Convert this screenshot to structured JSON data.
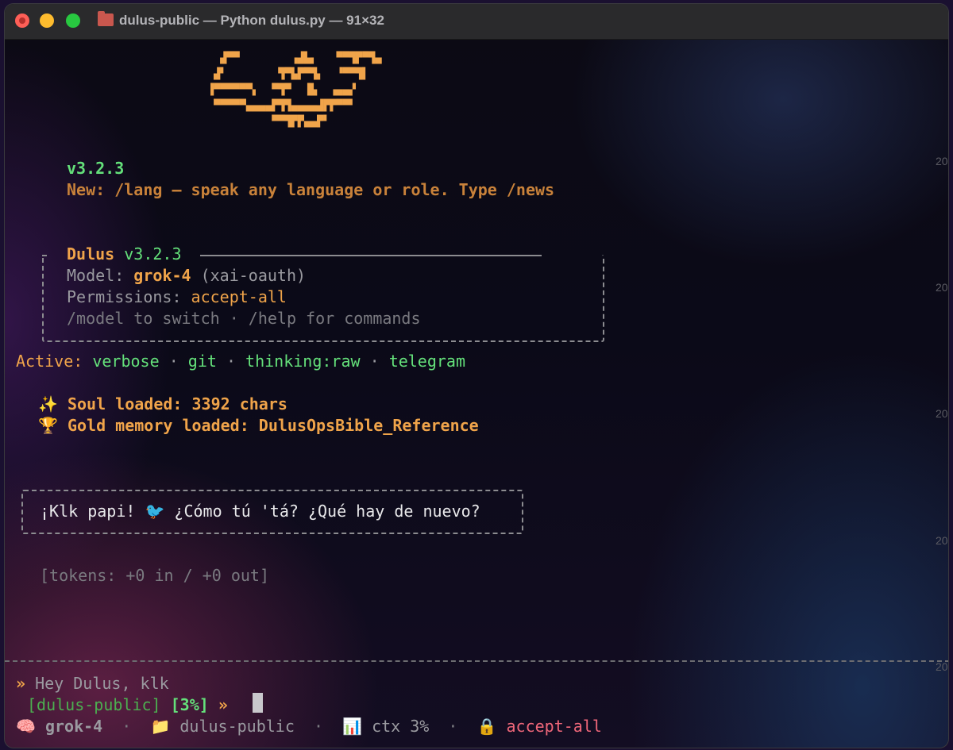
{
  "window": {
    "title": "dulus-public — Python dulus.py — 91×32"
  },
  "logo_ascii": "  ▟▀▀        ▗▟▙▖   ▀▀▜▛▀▜▄\n ▟▘        ▜▀▙▛▀▜▖  ▝▀▀▜▌\n▐▀▀▀▀▀▀▖  ▀▜▀  ▐▙  ▗▄▄▞\n ▀▀▀▀▀▄▄▄▄▛▜▜▄▄▄▄▟▛▛▀▀▘\n          ▀▀▜▛▛▄▄▛▘",
  "header": {
    "version": "v3.2.3",
    "news": "New: /lang — speak any language or role. Type /news"
  },
  "info_box": {
    "name": "Dulus",
    "version": "v3.2.3",
    "model_label": "Model:",
    "model_value": "grok-4",
    "model_provider": "(xai-oauth)",
    "permissions_label": "Permissions:",
    "permissions_value": "accept-all",
    "hint": "/model to switch · /help for commands"
  },
  "active": {
    "label": "Active:",
    "items": [
      "verbose",
      "git",
      "thinking:raw",
      "telegram"
    ],
    "separator": "·"
  },
  "loaded": {
    "soul_icon": "sparkles-icon",
    "soul_text": "Soul loaded: 3392 chars",
    "gold_icon": "trophy-icon",
    "gold_text": "Gold memory loaded: DulusOpsBible_Reference"
  },
  "assistant_message": {
    "before": "¡Klk papi! ",
    "icon": "bird-icon",
    "after": " ¿Cómo tú 'tá? ¿Qué hay de nuevo?"
  },
  "tokens": "[tokens: +0 in / +0 out]",
  "user_input": {
    "marker": "»",
    "text": "Hey Dulus, klk"
  },
  "prompt": {
    "project": "[dulus-public]",
    "ctx": "[3%]",
    "arrow": "»"
  },
  "status_bar": {
    "model_icon": "brain-icon",
    "model": "grok-4",
    "folder_icon": "folder-icon",
    "folder": "dulus-public",
    "ctx_icon": "bar-chart-icon",
    "ctx": "ctx 3%",
    "lock_icon": "lock-icon",
    "permissions": "accept-all",
    "separator": "·"
  },
  "right_edge_numbers": [
    "20",
    "20",
    "20",
    "20",
    "20"
  ],
  "colors": {
    "accent_orange": "#f0a44a",
    "accent_green": "#64e07a",
    "lock_red": "#f0677a"
  }
}
